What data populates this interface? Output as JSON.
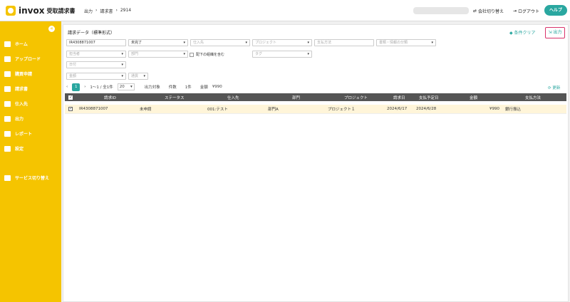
{
  "app": {
    "logo_text": "invox",
    "logo_sub": "受取請求書"
  },
  "breadcrumb": [
    "出力",
    "›",
    "請求書",
    "›",
    "2914"
  ],
  "header": {
    "switch_company": "会社切り替え",
    "logout": "ログアウト",
    "help": "ヘルプ"
  },
  "sidebar": {
    "items": [
      {
        "label": "ホーム",
        "icon": "home-icon"
      },
      {
        "label": "アップロード",
        "icon": "upload-icon"
      },
      {
        "label": "購買申請",
        "icon": "purchase-icon"
      },
      {
        "label": "請求書",
        "icon": "invoice-icon"
      },
      {
        "label": "仕入先",
        "icon": "supplier-icon"
      },
      {
        "label": "出力",
        "icon": "export-icon"
      },
      {
        "label": "レポート",
        "icon": "report-icon"
      },
      {
        "label": "設定",
        "icon": "gear-icon"
      },
      {
        "label": "サービス切り替え",
        "icon": "switch-icon"
      }
    ]
  },
  "panel": {
    "title": "請求データ（標準形式）",
    "clear": "条件クリア",
    "export": "出力"
  },
  "filters": {
    "invoice_id": "IR4308871007",
    "status": "未完了",
    "supplier": "仕入先",
    "project": "プロジェクト",
    "payment_method": "支払方法",
    "classification": "書類・情報の分類",
    "owner": "担当者",
    "dept": "部門",
    "include_sub": "配下の組織を含む",
    "tag": "タグ",
    "date": "日付",
    "amount": "金額",
    "currency": "通貨"
  },
  "pager": {
    "page": "1",
    "range": "1〜1 / 全1件",
    "page_size": "20",
    "target_label": "出力対象",
    "count_label": "件数",
    "count_value": "1件",
    "amount_label": "金額",
    "amount_value": "¥990",
    "refresh": "更新"
  },
  "table": {
    "headers": [
      "請求ID",
      "ステータス",
      "仕入先",
      "部門",
      "プロジェクト",
      "請求日",
      "支払予定日",
      "金額",
      "支払方法"
    ],
    "rows": [
      [
        "IR4308871007",
        "未申請",
        "001:テスト",
        "部門A",
        "プロジェクト１",
        "2024/6/17",
        "2024/6/28",
        "¥990",
        "銀行振込"
      ]
    ]
  },
  "colors": {
    "accent": "#2aa7a0",
    "sidebar": "#f5c400",
    "highlight": "#d8336b"
  }
}
